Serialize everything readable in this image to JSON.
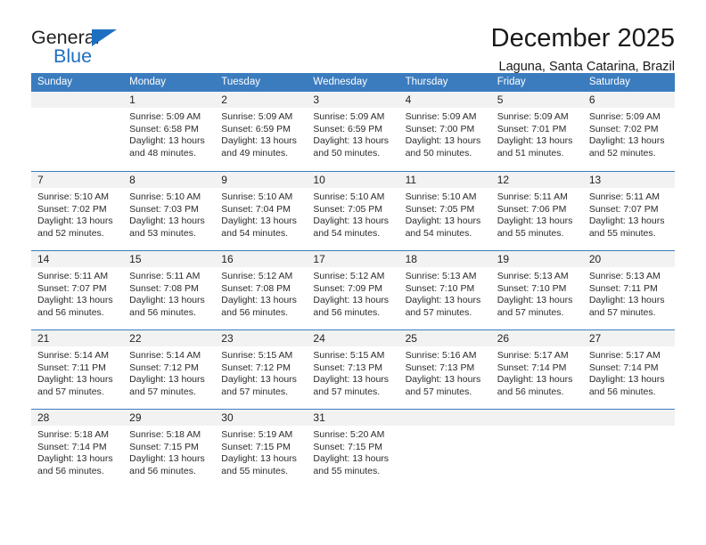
{
  "brand": {
    "name_part1": "General",
    "name_part2": "Blue",
    "accent_color": "#1f6fc0"
  },
  "header": {
    "title": "December 2025",
    "subtitle": "Laguna, Santa Catarina, Brazil"
  },
  "calendar": {
    "header_color": "#3b7cbf",
    "daynum_band_color": "#f2f2f2",
    "weekdays": [
      "Sunday",
      "Monday",
      "Tuesday",
      "Wednesday",
      "Thursday",
      "Friday",
      "Saturday"
    ],
    "weeks": [
      [
        {
          "day": "",
          "lines": []
        },
        {
          "day": "1",
          "lines": [
            "Sunrise: 5:09 AM",
            "Sunset: 6:58 PM",
            "Daylight: 13 hours",
            "and 48 minutes."
          ]
        },
        {
          "day": "2",
          "lines": [
            "Sunrise: 5:09 AM",
            "Sunset: 6:59 PM",
            "Daylight: 13 hours",
            "and 49 minutes."
          ]
        },
        {
          "day": "3",
          "lines": [
            "Sunrise: 5:09 AM",
            "Sunset: 6:59 PM",
            "Daylight: 13 hours",
            "and 50 minutes."
          ]
        },
        {
          "day": "4",
          "lines": [
            "Sunrise: 5:09 AM",
            "Sunset: 7:00 PM",
            "Daylight: 13 hours",
            "and 50 minutes."
          ]
        },
        {
          "day": "5",
          "lines": [
            "Sunrise: 5:09 AM",
            "Sunset: 7:01 PM",
            "Daylight: 13 hours",
            "and 51 minutes."
          ]
        },
        {
          "day": "6",
          "lines": [
            "Sunrise: 5:09 AM",
            "Sunset: 7:02 PM",
            "Daylight: 13 hours",
            "and 52 minutes."
          ]
        }
      ],
      [
        {
          "day": "7",
          "lines": [
            "Sunrise: 5:10 AM",
            "Sunset: 7:02 PM",
            "Daylight: 13 hours",
            "and 52 minutes."
          ]
        },
        {
          "day": "8",
          "lines": [
            "Sunrise: 5:10 AM",
            "Sunset: 7:03 PM",
            "Daylight: 13 hours",
            "and 53 minutes."
          ]
        },
        {
          "day": "9",
          "lines": [
            "Sunrise: 5:10 AM",
            "Sunset: 7:04 PM",
            "Daylight: 13 hours",
            "and 54 minutes."
          ]
        },
        {
          "day": "10",
          "lines": [
            "Sunrise: 5:10 AM",
            "Sunset: 7:05 PM",
            "Daylight: 13 hours",
            "and 54 minutes."
          ]
        },
        {
          "day": "11",
          "lines": [
            "Sunrise: 5:10 AM",
            "Sunset: 7:05 PM",
            "Daylight: 13 hours",
            "and 54 minutes."
          ]
        },
        {
          "day": "12",
          "lines": [
            "Sunrise: 5:11 AM",
            "Sunset: 7:06 PM",
            "Daylight: 13 hours",
            "and 55 minutes."
          ]
        },
        {
          "day": "13",
          "lines": [
            "Sunrise: 5:11 AM",
            "Sunset: 7:07 PM",
            "Daylight: 13 hours",
            "and 55 minutes."
          ]
        }
      ],
      [
        {
          "day": "14",
          "lines": [
            "Sunrise: 5:11 AM",
            "Sunset: 7:07 PM",
            "Daylight: 13 hours",
            "and 56 minutes."
          ]
        },
        {
          "day": "15",
          "lines": [
            "Sunrise: 5:11 AM",
            "Sunset: 7:08 PM",
            "Daylight: 13 hours",
            "and 56 minutes."
          ]
        },
        {
          "day": "16",
          "lines": [
            "Sunrise: 5:12 AM",
            "Sunset: 7:08 PM",
            "Daylight: 13 hours",
            "and 56 minutes."
          ]
        },
        {
          "day": "17",
          "lines": [
            "Sunrise: 5:12 AM",
            "Sunset: 7:09 PM",
            "Daylight: 13 hours",
            "and 56 minutes."
          ]
        },
        {
          "day": "18",
          "lines": [
            "Sunrise: 5:13 AM",
            "Sunset: 7:10 PM",
            "Daylight: 13 hours",
            "and 57 minutes."
          ]
        },
        {
          "day": "19",
          "lines": [
            "Sunrise: 5:13 AM",
            "Sunset: 7:10 PM",
            "Daylight: 13 hours",
            "and 57 minutes."
          ]
        },
        {
          "day": "20",
          "lines": [
            "Sunrise: 5:13 AM",
            "Sunset: 7:11 PM",
            "Daylight: 13 hours",
            "and 57 minutes."
          ]
        }
      ],
      [
        {
          "day": "21",
          "lines": [
            "Sunrise: 5:14 AM",
            "Sunset: 7:11 PM",
            "Daylight: 13 hours",
            "and 57 minutes."
          ]
        },
        {
          "day": "22",
          "lines": [
            "Sunrise: 5:14 AM",
            "Sunset: 7:12 PM",
            "Daylight: 13 hours",
            "and 57 minutes."
          ]
        },
        {
          "day": "23",
          "lines": [
            "Sunrise: 5:15 AM",
            "Sunset: 7:12 PM",
            "Daylight: 13 hours",
            "and 57 minutes."
          ]
        },
        {
          "day": "24",
          "lines": [
            "Sunrise: 5:15 AM",
            "Sunset: 7:13 PM",
            "Daylight: 13 hours",
            "and 57 minutes."
          ]
        },
        {
          "day": "25",
          "lines": [
            "Sunrise: 5:16 AM",
            "Sunset: 7:13 PM",
            "Daylight: 13 hours",
            "and 57 minutes."
          ]
        },
        {
          "day": "26",
          "lines": [
            "Sunrise: 5:17 AM",
            "Sunset: 7:14 PM",
            "Daylight: 13 hours",
            "and 56 minutes."
          ]
        },
        {
          "day": "27",
          "lines": [
            "Sunrise: 5:17 AM",
            "Sunset: 7:14 PM",
            "Daylight: 13 hours",
            "and 56 minutes."
          ]
        }
      ],
      [
        {
          "day": "28",
          "lines": [
            "Sunrise: 5:18 AM",
            "Sunset: 7:14 PM",
            "Daylight: 13 hours",
            "and 56 minutes."
          ]
        },
        {
          "day": "29",
          "lines": [
            "Sunrise: 5:18 AM",
            "Sunset: 7:15 PM",
            "Daylight: 13 hours",
            "and 56 minutes."
          ]
        },
        {
          "day": "30",
          "lines": [
            "Sunrise: 5:19 AM",
            "Sunset: 7:15 PM",
            "Daylight: 13 hours",
            "and 55 minutes."
          ]
        },
        {
          "day": "31",
          "lines": [
            "Sunrise: 5:20 AM",
            "Sunset: 7:15 PM",
            "Daylight: 13 hours",
            "and 55 minutes."
          ]
        },
        {
          "day": "",
          "lines": []
        },
        {
          "day": "",
          "lines": []
        },
        {
          "day": "",
          "lines": []
        }
      ]
    ]
  }
}
